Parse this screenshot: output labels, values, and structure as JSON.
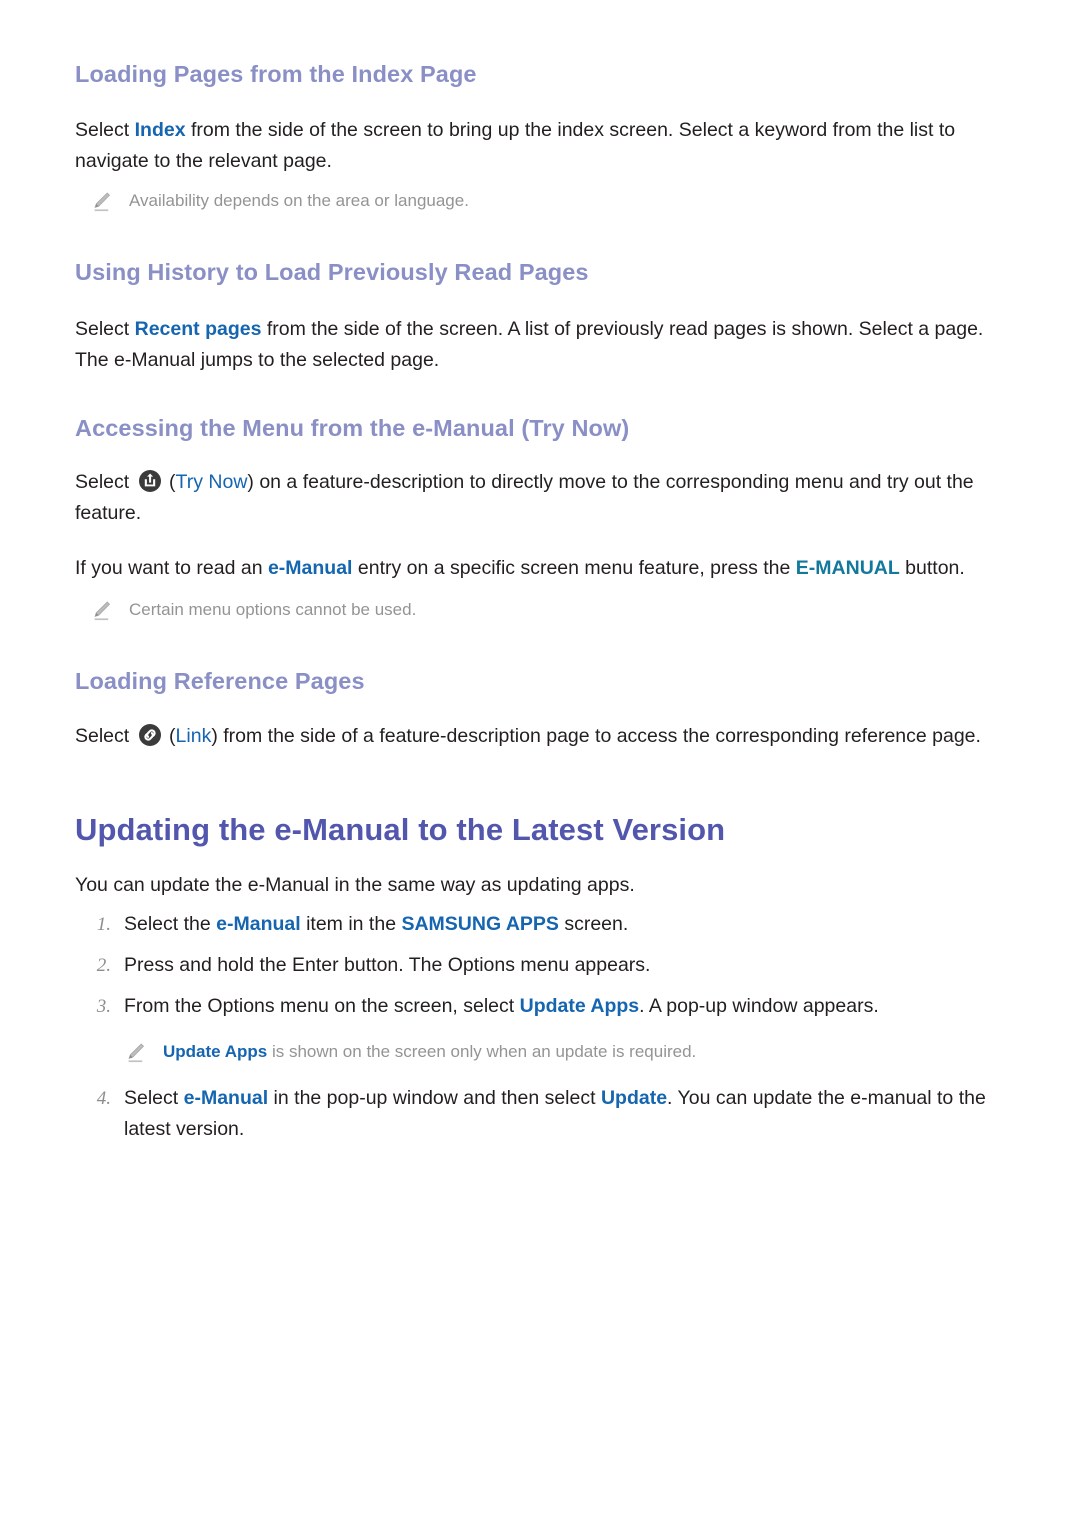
{
  "page": {
    "sections": [
      {
        "heading": "Loading Pages from the Index Page",
        "paragraph_pre": "Select ",
        "link1": "Index",
        "paragraph_post": " from the side of the screen to bring up the index screen. Select a keyword from the list to navigate to the relevant page.",
        "note": "Availability depends on the area or language."
      },
      {
        "heading": "Using History to Load Previously Read Pages",
        "paragraph_pre": "Select ",
        "link1": "Recent pages",
        "paragraph_post": " from the side of the screen. A list of previously read pages is shown. Select a page. The e-Manual jumps to the selected page."
      },
      {
        "heading": "Accessing the Menu from the e-Manual (Try Now)",
        "p1_pre": "Select ",
        "p1_icon": "try-now-icon",
        "p1_mid_open": " (",
        "p1_link": "Try Now",
        "p1_post": ") on a feature-description to directly move to the corresponding menu and try out the feature.",
        "p2_pre": "If you want to read an ",
        "p2_link1": "e-Manual",
        "p2_mid": " entry on a specific screen menu feature, press the ",
        "p2_link2": "E-MANUAL",
        "p2_post": " button.",
        "note": "Certain menu options cannot be used."
      },
      {
        "heading": "Loading Reference Pages",
        "p1_pre": "Select ",
        "p1_icon": "link-icon",
        "p1_mid_open": " (",
        "p1_link": "Link",
        "p1_post": ") from the side of a feature-description page to access the corresponding reference page."
      }
    ],
    "main": {
      "heading": "Updating the e-Manual to the Latest Version",
      "intro": "You can update the e-Manual in the same way as updating apps.",
      "steps": [
        {
          "num": "1.",
          "pre": "Select the ",
          "link1": "e-Manual",
          "mid": " item in the ",
          "link2": "SAMSUNG APPS",
          "post": " screen."
        },
        {
          "num": "2.",
          "pre": "Press and hold the Enter button. The Options menu appears.",
          "link1": "",
          "mid": "",
          "link2": "",
          "post": ""
        },
        {
          "num": "3.",
          "pre": "From the Options menu on the screen, select ",
          "link1": "Update Apps",
          "mid": ". A pop-up window appears.",
          "link2": "",
          "post": ""
        },
        {
          "num": "4.",
          "pre": "Select ",
          "link1": "e-Manual",
          "mid": " in the pop-up window and then select ",
          "link2": "Update",
          "post": ". You can update the e-manual to the latest version."
        }
      ],
      "note": {
        "link": "Update Apps",
        "text": " is shown on the screen only when an update is required."
      }
    },
    "colors": {
      "sub_heading": "#8a8fc6",
      "main_heading": "#5257ad",
      "link_blue": "#1565b0",
      "teal": "#12799c",
      "body_text": "#231f20",
      "note_gray": "#949494",
      "number_gray": "#8d8d8d",
      "icon_dark": "#3b3b3b",
      "background": "#ffffff"
    }
  }
}
